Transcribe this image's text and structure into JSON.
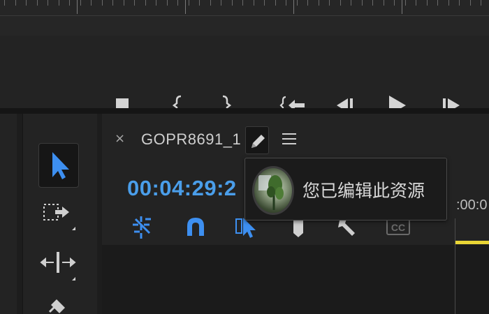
{
  "program_monitor": {
    "buttons": [
      {
        "name": "add-marker-button",
        "icon": "marker-icon"
      },
      {
        "name": "mark-in-button",
        "icon": "mark-in-icon"
      },
      {
        "name": "mark-out-button",
        "icon": "mark-out-icon"
      },
      {
        "name": "go-to-in-button",
        "icon": "go-to-in-icon"
      },
      {
        "name": "step-back-button",
        "icon": "step-back-icon"
      },
      {
        "name": "play-button",
        "icon": "play-icon"
      },
      {
        "name": "step-forward-button",
        "icon": "step-forward-icon"
      }
    ]
  },
  "tools": [
    {
      "name": "selection-tool",
      "icon": "selection-arrow-icon",
      "selected": true
    },
    {
      "name": "track-select-forward-tool",
      "icon": "track-select-icon",
      "selected": false
    },
    {
      "name": "ripple-edit-tool",
      "icon": "ripple-edit-icon",
      "selected": false
    },
    {
      "name": "razor-tool",
      "icon": "razor-icon",
      "selected": false
    }
  ],
  "timeline": {
    "close_label": "×",
    "sequence_name": "GOPR8691_1",
    "timecode": "00:04:29:2",
    "ruler_time": ":00:0",
    "tools": [
      {
        "name": "nest-toggle-button",
        "icon": "nest-icon"
      },
      {
        "name": "snap-button",
        "icon": "magnet-icon"
      },
      {
        "name": "linked-selection-button",
        "icon": "linked-selection-icon"
      },
      {
        "name": "add-marker-timeline-button",
        "icon": "marker-icon"
      },
      {
        "name": "timeline-settings-button",
        "icon": "wrench-icon"
      },
      {
        "name": "captions-button",
        "icon": "captions-icon",
        "label": "CC"
      }
    ]
  },
  "tooltip": {
    "text": "您已编辑此资源"
  },
  "colors": {
    "accent": "#4a9eea",
    "playhead_bar": "#e9d535",
    "background": "#232323"
  }
}
